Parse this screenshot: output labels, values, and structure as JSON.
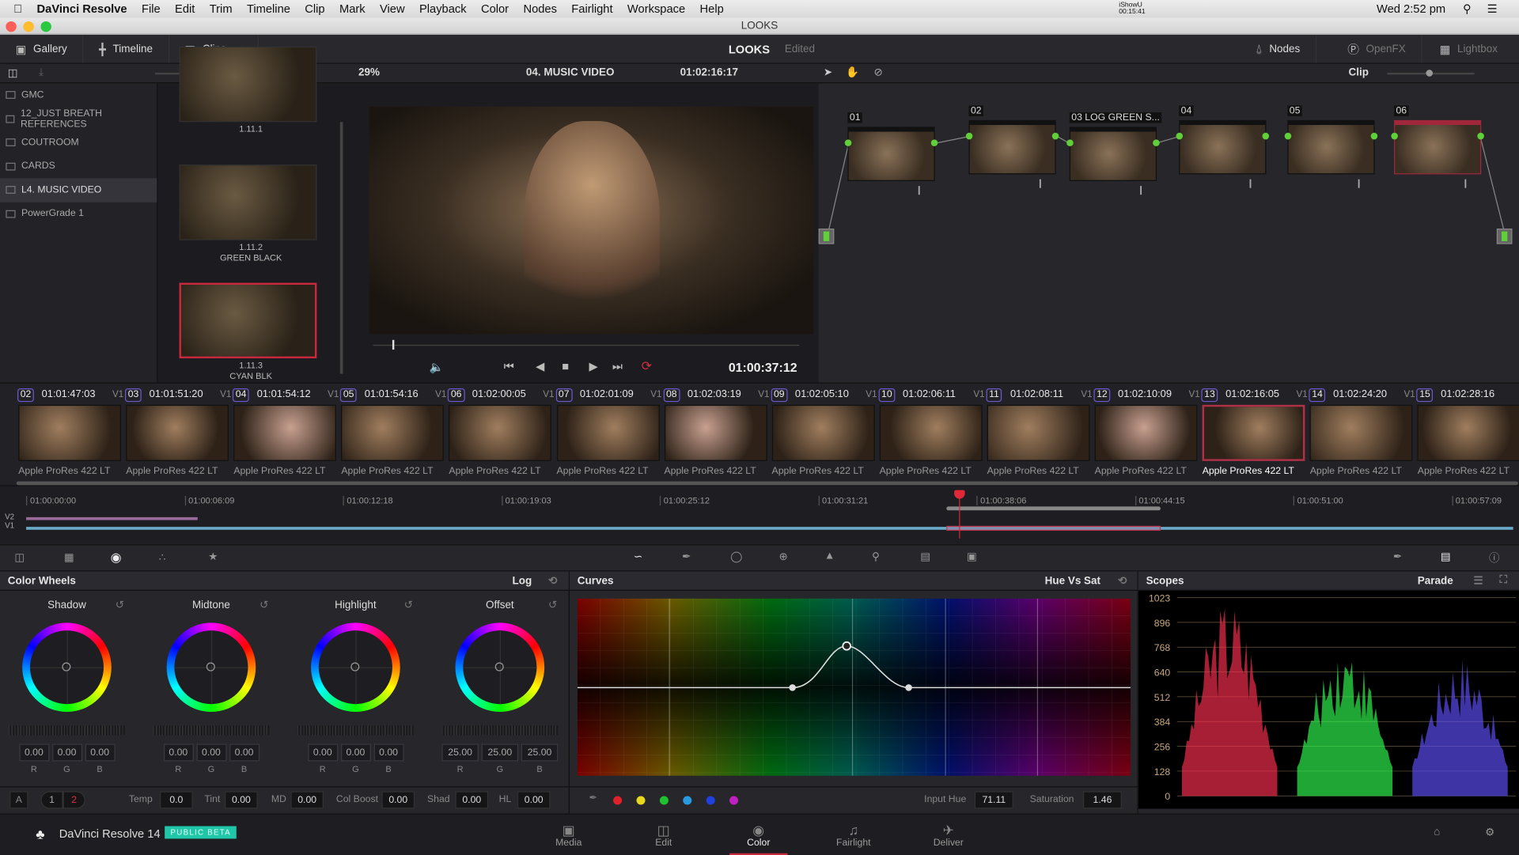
{
  "menubar": {
    "app": "DaVinci Resolve",
    "items": [
      "File",
      "Edit",
      "Trim",
      "Timeline",
      "Clip",
      "Mark",
      "View",
      "Playback",
      "Color",
      "Nodes",
      "Fairlight",
      "Workspace",
      "Help"
    ],
    "recorder": "iShowU",
    "recorder_time": "00:15:41",
    "clock": "Wed 2:52 pm"
  },
  "window": {
    "title": "LOOKS"
  },
  "toolbar": {
    "gallery": "Gallery",
    "timeline": "Timeline",
    "clips": "Clips",
    "page_title": "LOOKS",
    "status": "Edited",
    "nodes": "Nodes",
    "openfx": "OpenFX",
    "lightbox": "Lightbox"
  },
  "viewer": {
    "zoom": "29%",
    "timeline_name": "04. MUSIC VIDEO",
    "source_tc": "01:02:16:17",
    "node_mode": "Clip",
    "timecode": "01:00:37:12"
  },
  "gallery": {
    "albums": [
      "GMC",
      "12_JUST BREATH REFERENCES",
      "COUTROOM",
      "CARDS",
      "L4. MUSIC VIDEO",
      "PowerGrade 1"
    ],
    "selected": 4,
    "stills": [
      {
        "id": "1.11.1",
        "name": ""
      },
      {
        "id": "1.11.2",
        "name": "GREEN BLACK"
      },
      {
        "id": "1.11.3",
        "name": "CYAN BLK"
      }
    ]
  },
  "nodes": [
    {
      "label": "01"
    },
    {
      "label": "02"
    },
    {
      "label": "03 LOG GREEN S..."
    },
    {
      "label": "04"
    },
    {
      "label": "05"
    },
    {
      "label": "06"
    }
  ],
  "clips": [
    {
      "num": "02",
      "tc": "01:01:47:03",
      "track": "V1",
      "format": "Apple ProRes 422 LT"
    },
    {
      "num": "03",
      "tc": "01:01:51:20",
      "track": "V1",
      "format": "Apple ProRes 422 LT"
    },
    {
      "num": "04",
      "tc": "01:01:54:12",
      "track": "V1",
      "format": "Apple ProRes 422 LT"
    },
    {
      "num": "05",
      "tc": "01:01:54:16",
      "track": "V1",
      "format": "Apple ProRes 422 LT"
    },
    {
      "num": "06",
      "tc": "01:02:00:05",
      "track": "V1",
      "format": "Apple ProRes 422 LT"
    },
    {
      "num": "07",
      "tc": "01:02:01:09",
      "track": "V1",
      "format": "Apple ProRes 422 LT"
    },
    {
      "num": "08",
      "tc": "01:02:03:19",
      "track": "V1",
      "format": "Apple ProRes 422 LT"
    },
    {
      "num": "09",
      "tc": "01:02:05:10",
      "track": "V1",
      "format": "Apple ProRes 422 LT"
    },
    {
      "num": "10",
      "tc": "01:02:06:11",
      "track": "V1",
      "format": "Apple ProRes 422 LT"
    },
    {
      "num": "11",
      "tc": "01:02:08:11",
      "track": "V1",
      "format": "Apple ProRes 422 LT"
    },
    {
      "num": "12",
      "tc": "01:02:10:09",
      "track": "V1",
      "format": "Apple ProRes 422 LT"
    },
    {
      "num": "13",
      "tc": "01:02:16:05",
      "track": "V1",
      "format": "Apple ProRes 422 LT"
    },
    {
      "num": "14",
      "tc": "01:02:24:20",
      "track": "V1",
      "format": "Apple ProRes 422 LT"
    },
    {
      "num": "15",
      "tc": "01:02:28:16",
      "track": "",
      "format": "Apple ProRes 422 LT"
    }
  ],
  "selected_clip": 11,
  "timeline": {
    "ticks": [
      "01:00:00:00",
      "01:00:06:09",
      "01:00:12:18",
      "01:00:19:03",
      "01:00:25:12",
      "01:00:31:21",
      "01:00:38:06",
      "01:00:44:15",
      "01:00:51:00",
      "01:00:57:09"
    ],
    "tracks": [
      "V2",
      "V1"
    ]
  },
  "color_wheels": {
    "title": "Color Wheels",
    "mode": "Log",
    "wheels": [
      {
        "name": "Shadow",
        "r": "0.00",
        "g": "0.00",
        "b": "0.00"
      },
      {
        "name": "Midtone",
        "r": "0.00",
        "g": "0.00",
        "b": "0.00"
      },
      {
        "name": "Highlight",
        "r": "0.00",
        "g": "0.00",
        "b": "0.00"
      },
      {
        "name": "Offset",
        "r": "25.00",
        "g": "25.00",
        "b": "25.00"
      }
    ],
    "channel_labels": [
      "R",
      "G",
      "B"
    ],
    "a_label": "A",
    "page1": "1",
    "page2": "2",
    "params": [
      {
        "label": "Temp",
        "value": "0.0"
      },
      {
        "label": "Tint",
        "value": "0.00"
      },
      {
        "label": "MD",
        "value": "0.00"
      },
      {
        "label": "Col Boost",
        "value": "0.00"
      },
      {
        "label": "Shad",
        "value": "0.00"
      },
      {
        "label": "HL",
        "value": "0.00"
      }
    ]
  },
  "curves": {
    "title": "Curves",
    "mode": "Hue Vs Sat",
    "input_hue_label": "Input Hue",
    "input_hue": "71.11",
    "saturation_label": "Saturation",
    "saturation": "1.46",
    "swatches": [
      "#e0202a",
      "#e8d820",
      "#20c030",
      "#2a9ae0",
      "#2040e0",
      "#c020c0"
    ]
  },
  "scopes": {
    "title": "Scopes",
    "mode": "Parade",
    "scale": [
      "1023",
      "896",
      "768",
      "640",
      "512",
      "384",
      "256",
      "128",
      "0"
    ]
  },
  "footer": {
    "product": "DaVinci Resolve 14",
    "badge": "PUBLIC BETA",
    "pages": [
      "Media",
      "Edit",
      "Color",
      "Fairlight",
      "Deliver"
    ],
    "active_page": "Color"
  },
  "colors": {
    "accent": "#c8283c",
    "badge": "#1fc6a8",
    "node_dot": "#5fd03a"
  }
}
